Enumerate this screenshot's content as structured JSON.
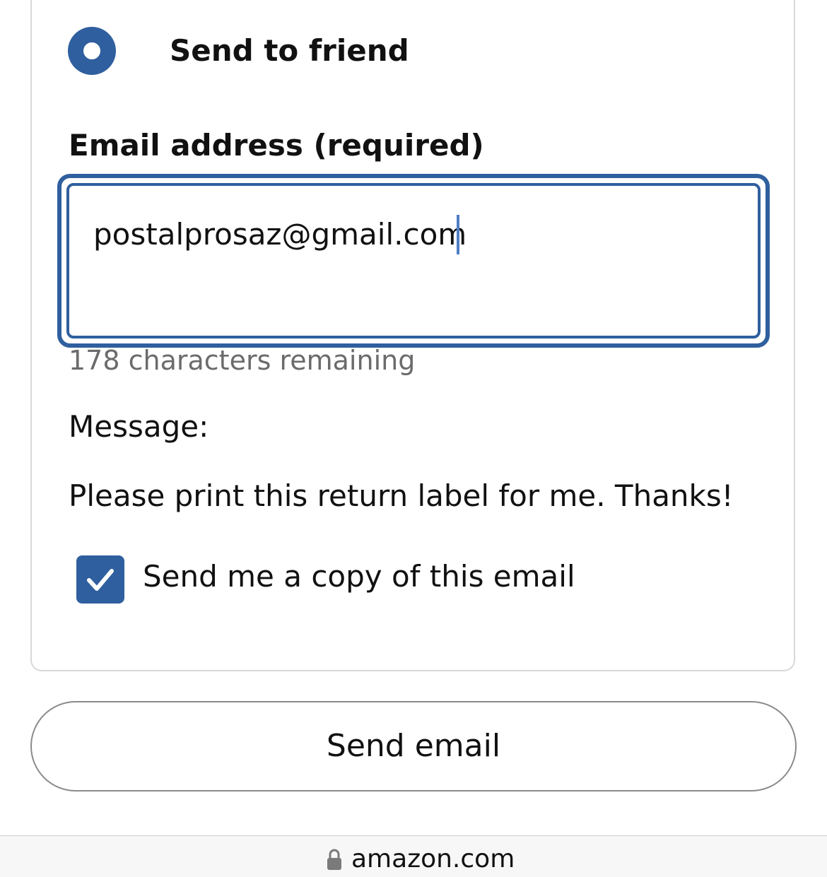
{
  "send_option": {
    "label": "Send to friend",
    "selected": true
  },
  "email_field": {
    "label": "Email address (required)",
    "value": "postalprosaz@gmail.com",
    "helper": "178 characters remaining"
  },
  "message": {
    "label": "Message:",
    "text": "Please print this return label for me. Thanks!"
  },
  "copy_checkbox": {
    "label": "Send me a copy of this email",
    "checked": true
  },
  "send_button": {
    "label": "Send email"
  },
  "browser_bar": {
    "domain": "amazon.com",
    "icon": "lock-icon"
  },
  "colors": {
    "accent": "#2f5f9e",
    "caret": "#4f7fc6",
    "helper_text": "#6b6b6b",
    "card_border": "#d8d8d8",
    "button_border": "#8a8a8a"
  }
}
